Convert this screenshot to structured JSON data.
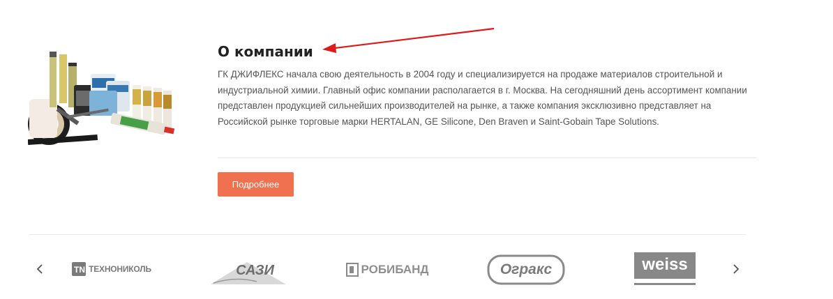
{
  "about": {
    "title": "О компании",
    "text": "ГК ДЖИФЛЕКС начала свою деятельность в 2004 году и специализируется на продаже материалов строительной и индустриальной химии. Главный офис компании располагается в г. Москва. На сегодняшний день ассортимент компании представлен продукцией сильнейших производителей на рынке, а также компания эксклюзивно представляет на Российской рынке торговые марки HERTALAN, GE Silicone, Den Braven и Saint-Gobain Tape Solutions.",
    "button_label": "Подробнее"
  },
  "brands": [
    {
      "name": "ТЕХНОНИКОЛЬ"
    },
    {
      "name": "САЗИ"
    },
    {
      "name": "РОБИБАНД"
    },
    {
      "name": "Огракс"
    },
    {
      "name": "weiss"
    }
  ],
  "colors": {
    "accent": "#ef7150",
    "annotation_arrow": "#e0191b",
    "brand_grey": "#7a7a7a"
  },
  "icons": {
    "prev": "chevron-left-icon",
    "next": "chevron-right-icon"
  }
}
